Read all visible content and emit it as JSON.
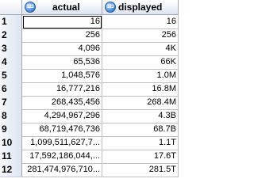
{
  "headers": {
    "actual": "actual",
    "displayed": "displayed",
    "badge": "123"
  },
  "rows": [
    {
      "num": "1",
      "actual": "16",
      "displayed": "16"
    },
    {
      "num": "2",
      "actual": "256",
      "displayed": "256"
    },
    {
      "num": "3",
      "actual": "4,096",
      "displayed": "4K"
    },
    {
      "num": "4",
      "actual": "65,536",
      "displayed": "66K"
    },
    {
      "num": "5",
      "actual": "1,048,576",
      "displayed": "1.0M"
    },
    {
      "num": "6",
      "actual": "16,777,216",
      "displayed": "16.8M"
    },
    {
      "num": "7",
      "actual": "268,435,456",
      "displayed": "268.4M"
    },
    {
      "num": "8",
      "actual": "4,294,967,296",
      "displayed": "4.3B"
    },
    {
      "num": "9",
      "actual": "68,719,476,736",
      "displayed": "68.7B"
    },
    {
      "num": "10",
      "actual": "1,099,511,627,7...",
      "displayed": "1.1T"
    },
    {
      "num": "11",
      "actual": "17,592,186,044,...",
      "displayed": "17.6T"
    },
    {
      "num": "12",
      "actual": "281,474,976,710...",
      "displayed": "281.5T"
    }
  ]
}
